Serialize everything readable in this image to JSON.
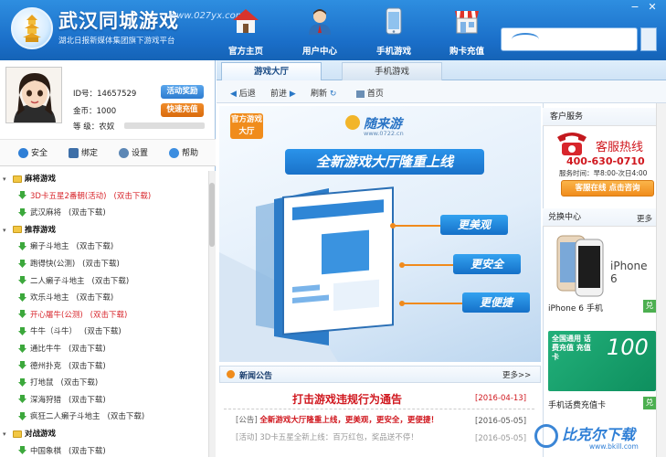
{
  "header": {
    "title": "武汉同城游戏",
    "url": "www.027yx.com",
    "subtitle": "湖北日报新媒体集团旗下游戏平台",
    "nav": [
      {
        "label": "官方主页",
        "icon": "house-icon"
      },
      {
        "label": "用户中心",
        "icon": "user-icon"
      },
      {
        "label": "手机游戏",
        "icon": "phone-icon"
      },
      {
        "label": "购卡充值",
        "icon": "shop-icon"
      }
    ],
    "window_controls": [
      "−",
      "✕"
    ]
  },
  "user": {
    "id_label": "ID号：",
    "id_value": "14657529",
    "gold_label": "金币：",
    "gold_value": "1000",
    "level_label": "等  级：",
    "level_value": "农奴",
    "reward_button": "活动奖励",
    "recharge_button": "快速充值"
  },
  "toolbar": {
    "security": "安全",
    "bind": "绑定",
    "settings": "设置",
    "help": "帮助"
  },
  "tree": {
    "categories": [
      {
        "name": "麻将游戏",
        "items": [
          {
            "name": "3D卡五星2番朝(活动)",
            "action": "(双击下载)",
            "highlight": true
          },
          {
            "name": "武汉麻将",
            "action": "(双击下载)",
            "highlight": false
          }
        ]
      },
      {
        "name": "推荐游戏",
        "items": [
          {
            "name": "癞子斗地主",
            "action": "(双击下载)",
            "highlight": false
          },
          {
            "name": "跑得快(公测)",
            "action": "(双击下载)",
            "highlight": false
          },
          {
            "name": "二人癞子斗地主",
            "action": "(双击下载)",
            "highlight": false
          },
          {
            "name": "欢乐斗地主",
            "action": "(双击下载)",
            "highlight": false
          },
          {
            "name": "开心屠牛(公测)",
            "action": "(双击下载)",
            "highlight": true
          },
          {
            "name": "牛牛（斗牛）",
            "action": "(双击下载)",
            "highlight": false
          },
          {
            "name": "通比牛牛",
            "action": "(双击下载)",
            "highlight": false
          },
          {
            "name": "德州扑克",
            "action": "(双击下载)",
            "highlight": false
          },
          {
            "name": "打地鼠",
            "action": "(双击下载)",
            "highlight": false
          },
          {
            "name": "深海狩猎",
            "action": "(双击下载)",
            "highlight": false
          },
          {
            "name": "疯狂二人癞子斗地主",
            "action": "(双击下载)",
            "highlight": false
          }
        ]
      },
      {
        "name": "对战游戏",
        "items": [
          {
            "name": "中国象棋",
            "action": "(双击下载)",
            "highlight": false
          }
        ]
      }
    ]
  },
  "tabs": [
    {
      "label": "游戏大厅",
      "active": true
    },
    {
      "label": "手机游戏",
      "active": false
    }
  ],
  "browser": {
    "back": "后退",
    "forward": "前进",
    "refresh": "刷新",
    "home": "首页"
  },
  "banner": {
    "official_badge": "官方游戏大厅",
    "brand": "随来游",
    "brand_url": "www.0722.cn",
    "headline": "全新游戏大厅隆重上线",
    "features": [
      "更美观",
      "更安全",
      "更便捷"
    ]
  },
  "news": {
    "title": "新闻公告",
    "more": "更多>>",
    "featured": {
      "title": "打击游戏违规行为通告",
      "date": "[2016-04-13]"
    },
    "items": [
      {
        "tag": "[公告]",
        "text": "全新游戏大厅隆重上线，更美观，更安全，更便捷！",
        "date": "[2016-05-05]"
      },
      {
        "tag": "[活动]",
        "text": "3D卡五星全新上线：百万红包，奖品送不停！",
        "date": "[2016-05-05]"
      }
    ]
  },
  "service": {
    "title": "客户服务",
    "hotline_label": "客服热线",
    "phone": "400-630-0710",
    "hours": "服务时间：早8:00-次日4:00",
    "online_button": "客服在线 点击咨询"
  },
  "exchange": {
    "title": "兑换中心",
    "more": "更多",
    "items": [
      {
        "name": "iPhone 6 手机",
        "image_text": "iPhone 6",
        "action": "兑"
      },
      {
        "name": "手机话费充值卡",
        "image_text": "全国通用 话费充值 充值卡",
        "amount": "100",
        "action": "兑"
      }
    ]
  },
  "watermark": {
    "text": "比克尔下载",
    "url": "www.bkill.com"
  }
}
